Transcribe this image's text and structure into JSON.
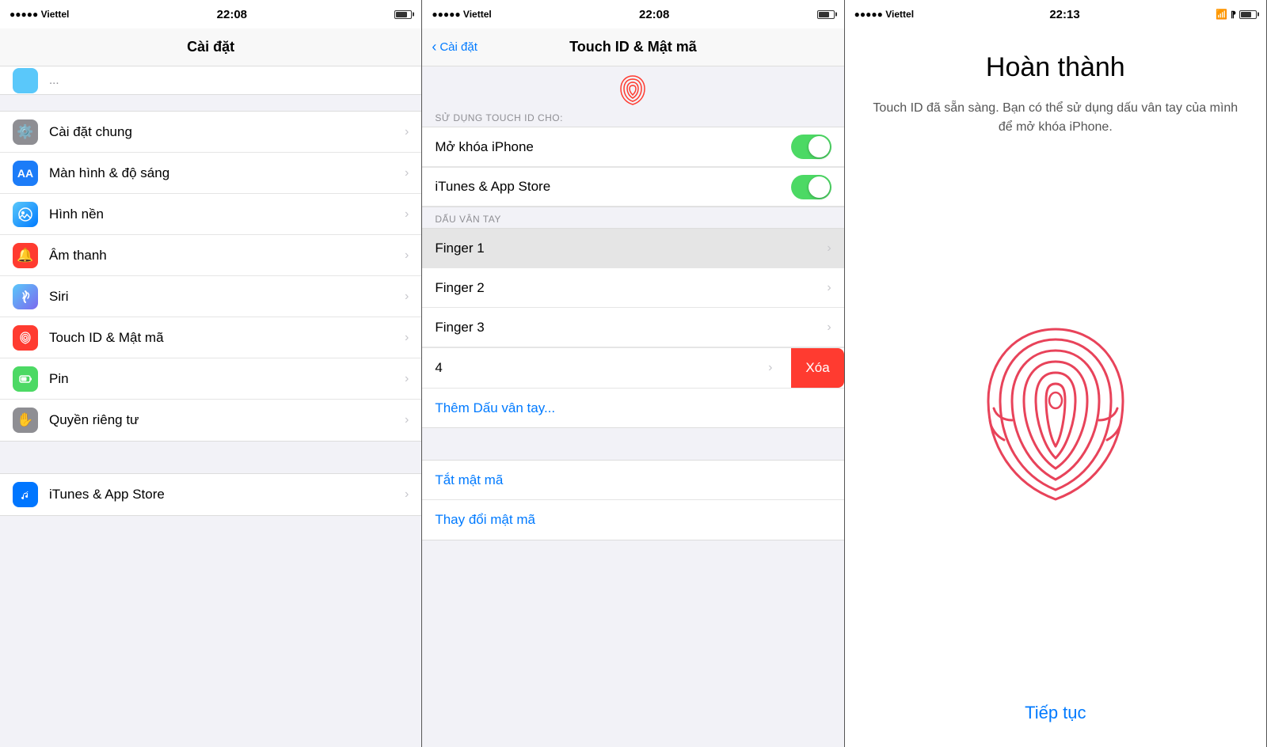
{
  "panel1": {
    "statusBar": {
      "carrier": "●●●●● Viettel",
      "time": "22:08",
      "battery": "75"
    },
    "navTitle": "Cài đặt",
    "partialItem": "...",
    "items": [
      {
        "id": "general",
        "label": "Cài đặt chung",
        "iconBg": "#8e8e93",
        "iconChar": "⚙️"
      },
      {
        "id": "display",
        "label": "Màn hình & độ sáng",
        "iconBg": "#1c7cf8",
        "iconChar": "AA"
      },
      {
        "id": "wallpaper",
        "label": "Hình nền",
        "iconBg": "#1c7cf8",
        "iconChar": "✦"
      },
      {
        "id": "sound",
        "label": "Âm thanh",
        "iconBg": "#ff3b30",
        "iconChar": "🔊"
      },
      {
        "id": "siri",
        "label": "Siri",
        "iconBg": "#1c7cf8",
        "iconChar": "◈"
      },
      {
        "id": "touchid",
        "label": "Touch ID & Mật mã",
        "iconBg": "#ff3b30",
        "iconChar": "👆"
      },
      {
        "id": "battery",
        "label": "Pin",
        "iconBg": "#4cd964",
        "iconChar": "💬"
      },
      {
        "id": "privacy",
        "label": "Quyền riêng tư",
        "iconBg": "#8e8e93",
        "iconChar": "✋"
      },
      {
        "id": "itunes",
        "label": "iTunes & App Store",
        "iconBg": "#0076ff",
        "iconChar": "A"
      }
    ]
  },
  "panel2": {
    "statusBar": {
      "carrier": "●●●●● Viettel",
      "time": "22:08",
      "battery": "75"
    },
    "navBack": "Cài đặt",
    "navTitle": "Touch ID & Mật mã",
    "sectionTouchId": "SỬ DỤNG TOUCH ID CHO:",
    "toggleItems": [
      {
        "id": "unlock",
        "label": "Mở khóa iPhone",
        "on": true
      },
      {
        "id": "itunes",
        "label": "iTunes & App Store",
        "on": true
      }
    ],
    "sectionFingerprint": "DẤU VÂN TAY",
    "fingerprints": [
      {
        "id": "f1",
        "label": "Finger 1",
        "highlighted": true
      },
      {
        "id": "f2",
        "label": "Finger 2",
        "highlighted": false
      },
      {
        "id": "f3",
        "label": "Finger 3",
        "highlighted": false
      }
    ],
    "deletingItem": "4",
    "deleteLabel": "Xóa",
    "addLabel": "Thêm Dấu vân tay...",
    "passcodeItems": [
      {
        "id": "turnoff",
        "label": "Tắt mật mã"
      },
      {
        "id": "change",
        "label": "Thay đổi mật mã"
      }
    ]
  },
  "panel3": {
    "statusBar": {
      "carrier": "●●●●● Viettel",
      "time": "22:13",
      "wifi": true,
      "bt": true
    },
    "title": "Hoàn thành",
    "description": "Touch ID đã sẵn sàng. Bạn có thể sử dụng dấu vân tay của mình để mở khóa iPhone.",
    "continueLabel": "Tiếp tục"
  }
}
